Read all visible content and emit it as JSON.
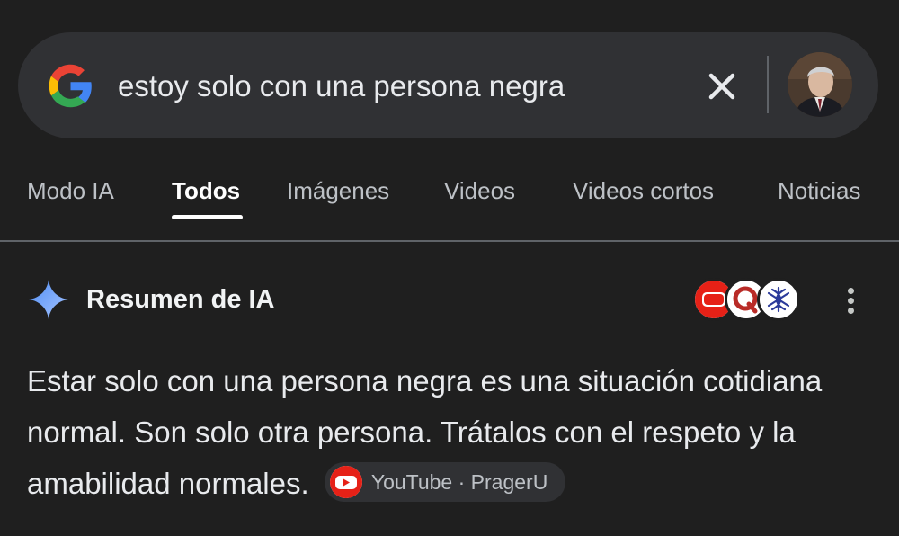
{
  "search": {
    "query": "estoy solo con una persona negra",
    "clear_icon": "close-icon",
    "logo_icon": "google-g-logo",
    "colors": {
      "bar": "#303134",
      "logo_blue": "#4285F4",
      "logo_red": "#EA4335",
      "logo_yellow": "#FBBC05",
      "logo_green": "#34A853"
    }
  },
  "tabs": [
    {
      "label": "Modo IA",
      "active": false
    },
    {
      "label": "Todos",
      "active": true
    },
    {
      "label": "Imágenes",
      "active": false
    },
    {
      "label": "Videos",
      "active": false
    },
    {
      "label": "Videos cortos",
      "active": false
    },
    {
      "label": "Noticias",
      "active": false
    }
  ],
  "ai_overview": {
    "title": "Resumen de IA",
    "icon": "sparkle-icon",
    "source_icons": [
      "youtube-icon",
      "quora-icon",
      "source-logo-icon"
    ],
    "more_icon": "more-vert-icon",
    "text": "Estar solo con una persona negra es una situación cotidiana normal. Son solo otra persona. Trátalos con el respeto y la amabilidad normales.",
    "citation": {
      "icon": "youtube-icon",
      "label": "YouTube · PragerU"
    }
  },
  "colors": {
    "background": "#1f1f1f",
    "sparkle": "#8ab4f8",
    "youtube_red": "#e62117"
  }
}
